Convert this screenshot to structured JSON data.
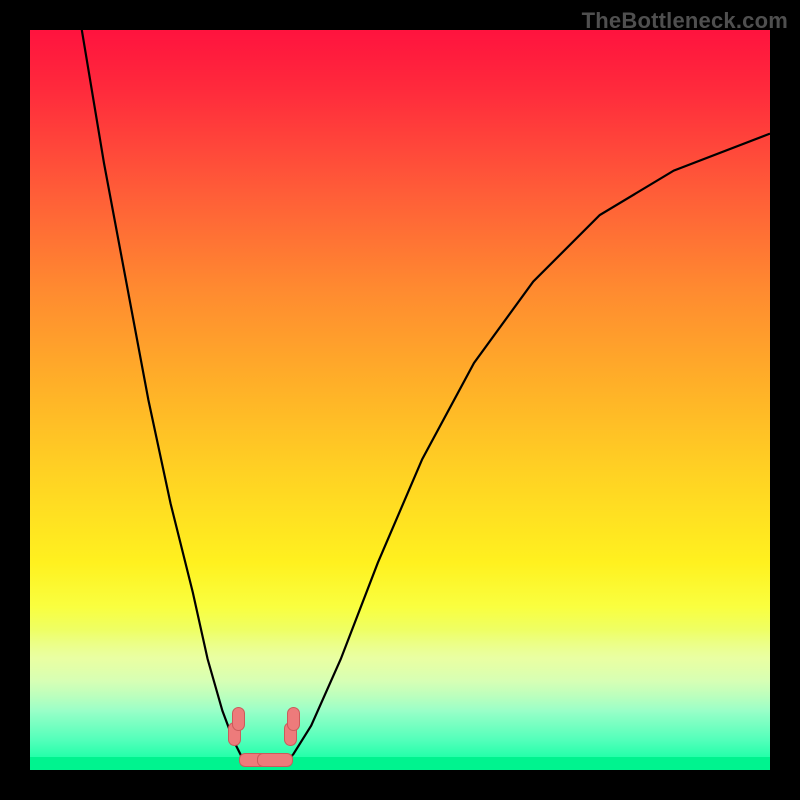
{
  "attribution": "TheBottleneck.com",
  "chart_data": {
    "type": "line",
    "title": "",
    "xlabel": "",
    "ylabel": "",
    "xlim": [
      0,
      100
    ],
    "ylim": [
      0,
      100
    ],
    "background_gradient": {
      "top_color": "#ff133e",
      "bottom_color": "#00ff9c",
      "stops": [
        {
          "pos": 0.0,
          "color": "#ff133e"
        },
        {
          "pos": 0.22,
          "color": "#ff5d38"
        },
        {
          "pos": 0.48,
          "color": "#ffb028"
        },
        {
          "pos": 0.72,
          "color": "#fff11f"
        },
        {
          "pos": 0.88,
          "color": "#ccffb0"
        },
        {
          "pos": 1.0,
          "color": "#00ff9c"
        }
      ]
    },
    "series": [
      {
        "name": "left-branch",
        "x": [
          7,
          10,
          13,
          16,
          19,
          22,
          24,
          26,
          27.5,
          28.5
        ],
        "y": [
          100,
          82,
          66,
          50,
          36,
          24,
          15,
          8,
          4,
          2
        ]
      },
      {
        "name": "bottom-flat",
        "x": [
          28.5,
          30,
          32,
          34,
          35.5
        ],
        "y": [
          2,
          1,
          1,
          1,
          2
        ]
      },
      {
        "name": "right-branch",
        "x": [
          35.5,
          38,
          42,
          47,
          53,
          60,
          68,
          77,
          87,
          100
        ],
        "y": [
          2,
          6,
          15,
          28,
          42,
          55,
          66,
          75,
          81,
          86
        ]
      }
    ],
    "markers": [
      {
        "shape": "vpill",
        "x": 27.5,
        "y": 5
      },
      {
        "shape": "vpill",
        "x": 28.0,
        "y": 7
      },
      {
        "shape": "vpill",
        "x": 35.0,
        "y": 5
      },
      {
        "shape": "vpill",
        "x": 35.5,
        "y": 7
      },
      {
        "shape": "hpill",
        "x": 30.5,
        "y": 1.5
      },
      {
        "shape": "hpill",
        "x": 33.0,
        "y": 1.5
      }
    ],
    "baseline": {
      "y": 0,
      "color": "#00f38f",
      "thickness_pct": 1.8
    }
  }
}
